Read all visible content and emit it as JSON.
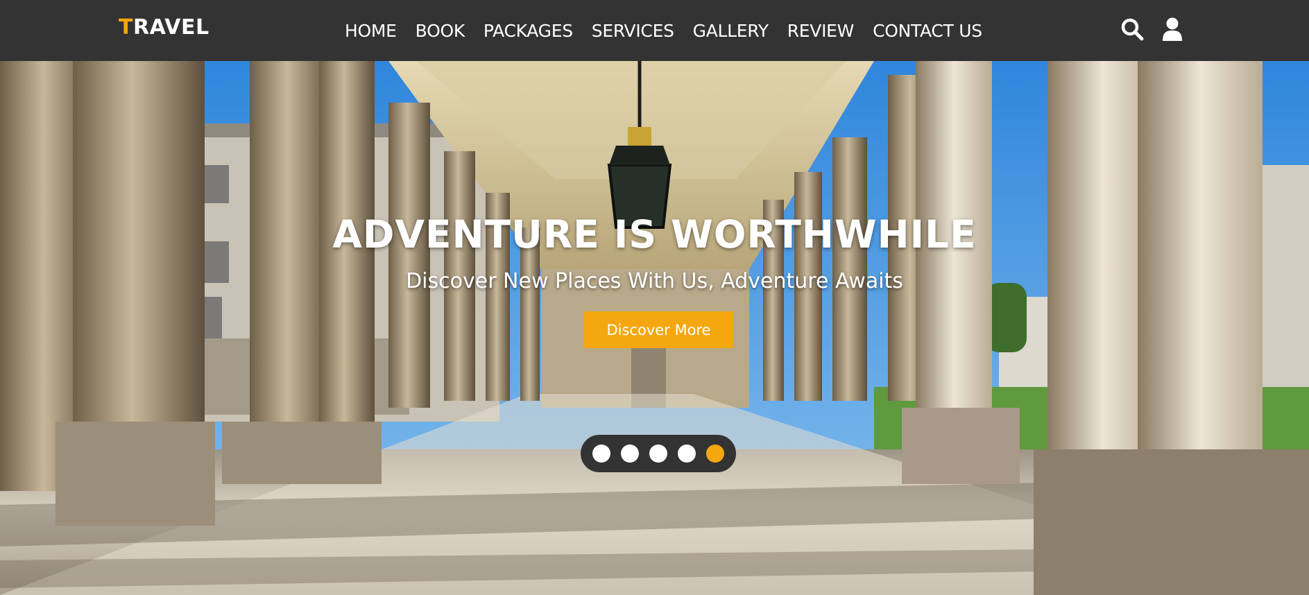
{
  "brand": {
    "logo_first_letter": "T",
    "logo_rest": "RAVEL"
  },
  "nav": {
    "items": [
      "HOME",
      "BOOK",
      "PACKAGES",
      "SERVICES",
      "GALLERY",
      "REVIEW",
      "CONTACT US"
    ],
    "search_icon": "search-icon",
    "user_icon": "user-icon"
  },
  "hero": {
    "title": "ADVENTURE IS WORTHWHILE",
    "subtitle": "Discover New Places With Us, Adventure Awaits",
    "cta_label": "Discover More",
    "slides_total": 5,
    "active_slide": 5
  },
  "colors": {
    "navbar": "#333333",
    "accent": "#f5a70f",
    "text": "#ffffff"
  }
}
